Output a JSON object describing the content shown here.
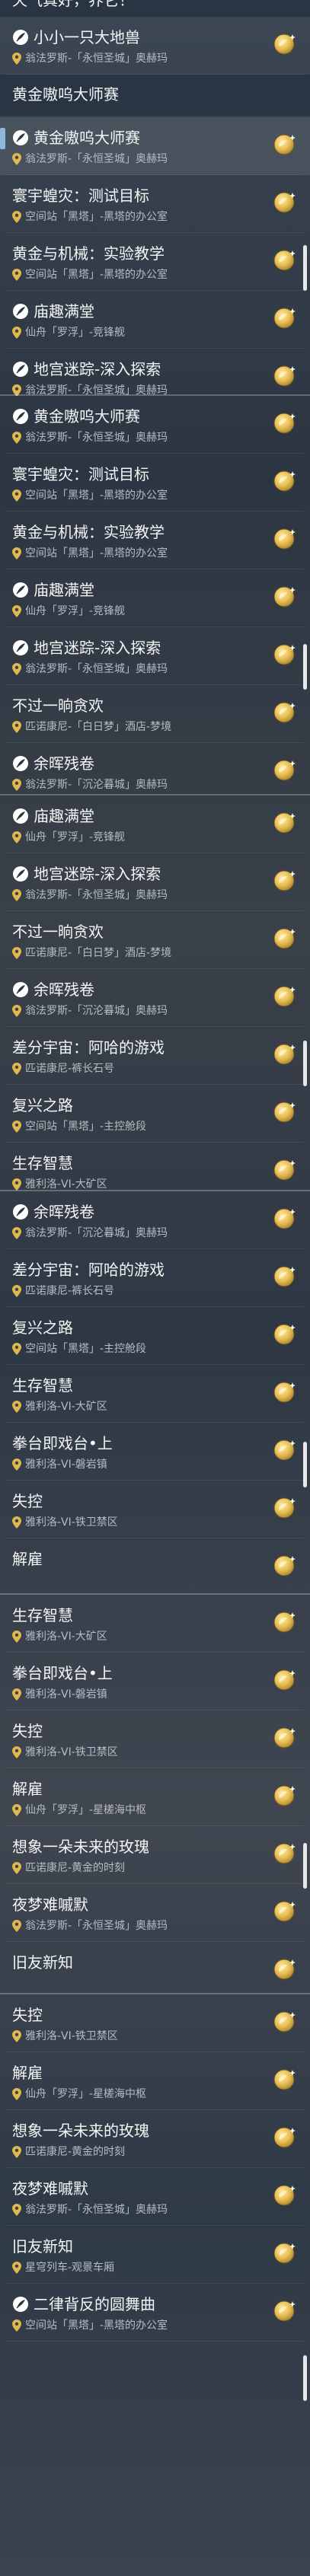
{
  "icons": {
    "quest": "quest-feather-icon",
    "location": "location-pin-icon",
    "badge": "gold-reward-badge-icon"
  },
  "colors": {
    "accent": "#8fb8de",
    "badge_gold": "#e7bf55",
    "pin_gold": "#e0b84c"
  },
  "segments": [
    {
      "partial_header": "天气真好，养它！",
      "cards": [
        {
          "title": "小小一只大地兽",
          "location": "翁法罗斯-「永恒圣城」奥赫玛",
          "quest_icon": true
        },
        {
          "title": "黄金嗷呜大师赛",
          "location": "",
          "header": true
        },
        {
          "title": "黄金嗷呜大师赛",
          "location": "翁法罗斯-「永恒圣城」奥赫玛",
          "quest_icon": true,
          "selected": true
        },
        {
          "title": "寰宇蝗灾：测试目标",
          "location": "空间站「黑塔」-黑塔的办公室"
        },
        {
          "title": "黄金与机械：实验教学",
          "location": "空间站「黑塔」-黑塔的办公室"
        },
        {
          "title": "庙趣满堂",
          "location": "仙舟「罗浮」-竞锋舰",
          "quest_icon": true
        },
        {
          "title": "地宫迷踪-深入探索",
          "location": "翁法罗斯-「永恒圣城」奥赫玛",
          "quest_icon": true,
          "partial": true
        }
      ]
    },
    {
      "cards": [
        {
          "title": "黄金嗷呜大师赛",
          "location": "翁法罗斯-「永恒圣城」奥赫玛",
          "quest_icon": true
        },
        {
          "title": "寰宇蝗灾：测试目标",
          "location": "空间站「黑塔」-黑塔的办公室"
        },
        {
          "title": "黄金与机械：实验教学",
          "location": "空间站「黑塔」-黑塔的办公室"
        },
        {
          "title": "庙趣满堂",
          "location": "仙舟「罗浮」-竞锋舰",
          "quest_icon": true
        },
        {
          "title": "地宫迷踪-深入探索",
          "location": "翁法罗斯-「永恒圣城」奥赫玛",
          "quest_icon": true
        },
        {
          "title": "不过一晌贪欢",
          "location": "匹诺康尼-「白日梦」酒店-梦境"
        },
        {
          "title": "余晖残卷",
          "location": "翁法罗斯-「沉沦暮城」奥赫玛",
          "quest_icon": true
        }
      ]
    },
    {
      "cards": [
        {
          "title": "庙趣满堂",
          "location": "仙舟「罗浮」-竞锋舰",
          "quest_icon": true
        },
        {
          "title": "地宫迷踪-深入探索",
          "location": "翁法罗斯-「永恒圣城」奥赫玛",
          "quest_icon": true
        },
        {
          "title": "不过一晌贪欢",
          "location": "匹诺康尼-「白日梦」酒店-梦境"
        },
        {
          "title": "余晖残卷",
          "location": "翁法罗斯-「沉沦暮城」奥赫玛",
          "quest_icon": true
        },
        {
          "title": "差分宇宙：阿哈的游戏",
          "location": "匹诺康尼-裤长石号"
        },
        {
          "title": "复兴之路",
          "location": "空间站「黑塔」-主控舱段"
        },
        {
          "title": "生存智慧",
          "location": "雅利洛-VI-大矿区"
        }
      ]
    },
    {
      "cards": [
        {
          "title": "余晖残卷",
          "location": "翁法罗斯-「沉沦暮城」奥赫玛",
          "quest_icon": true
        },
        {
          "title": "差分宇宙：阿哈的游戏",
          "location": "匹诺康尼-裤长石号"
        },
        {
          "title": "复兴之路",
          "location": "空间站「黑塔」-主控舱段"
        },
        {
          "title": "生存智慧",
          "location": "雅利洛-VI-大矿区"
        },
        {
          "title": "拳台即戏台•上",
          "location": "雅利洛-VI-磐岩镇"
        },
        {
          "title": "失控",
          "location": "雅利洛-VI-铁卫禁区"
        },
        {
          "title": "解雇",
          "location": "",
          "partial": true
        }
      ]
    },
    {
      "cards": [
        {
          "title": "生存智慧",
          "location": "雅利洛-VI-大矿区"
        },
        {
          "title": "拳台即戏台•上",
          "location": "雅利洛-VI-磐岩镇"
        },
        {
          "title": "失控",
          "location": "雅利洛-VI-铁卫禁区"
        },
        {
          "title": "解雇",
          "location": "仙舟「罗浮」-星槎海中枢"
        },
        {
          "title": "想象一朵未来的玫瑰",
          "location": "匹诺康尼-黄金的时刻"
        },
        {
          "title": "夜梦难嘁默",
          "location": "翁法罗斯-「永恒圣城」奥赫玛"
        },
        {
          "title": "旧友新知",
          "location": "",
          "partial": true
        }
      ]
    },
    {
      "cards": [
        {
          "title": "失控",
          "location": "雅利洛-VI-铁卫禁区"
        },
        {
          "title": "解雇",
          "location": "仙舟「罗浮」-星槎海中枢"
        },
        {
          "title": "想象一朵未来的玫瑰",
          "location": "匹诺康尼-黄金的时刻"
        },
        {
          "title": "夜梦难嘁默",
          "location": "翁法罗斯-「永恒圣城」奥赫玛"
        },
        {
          "title": "旧友新知",
          "location": "星穹列车-观景车厢"
        },
        {
          "title": "二律背反的圆舞曲",
          "location": "空间站「黑塔」-黑塔的办公室",
          "quest_icon": true
        }
      ]
    }
  ]
}
